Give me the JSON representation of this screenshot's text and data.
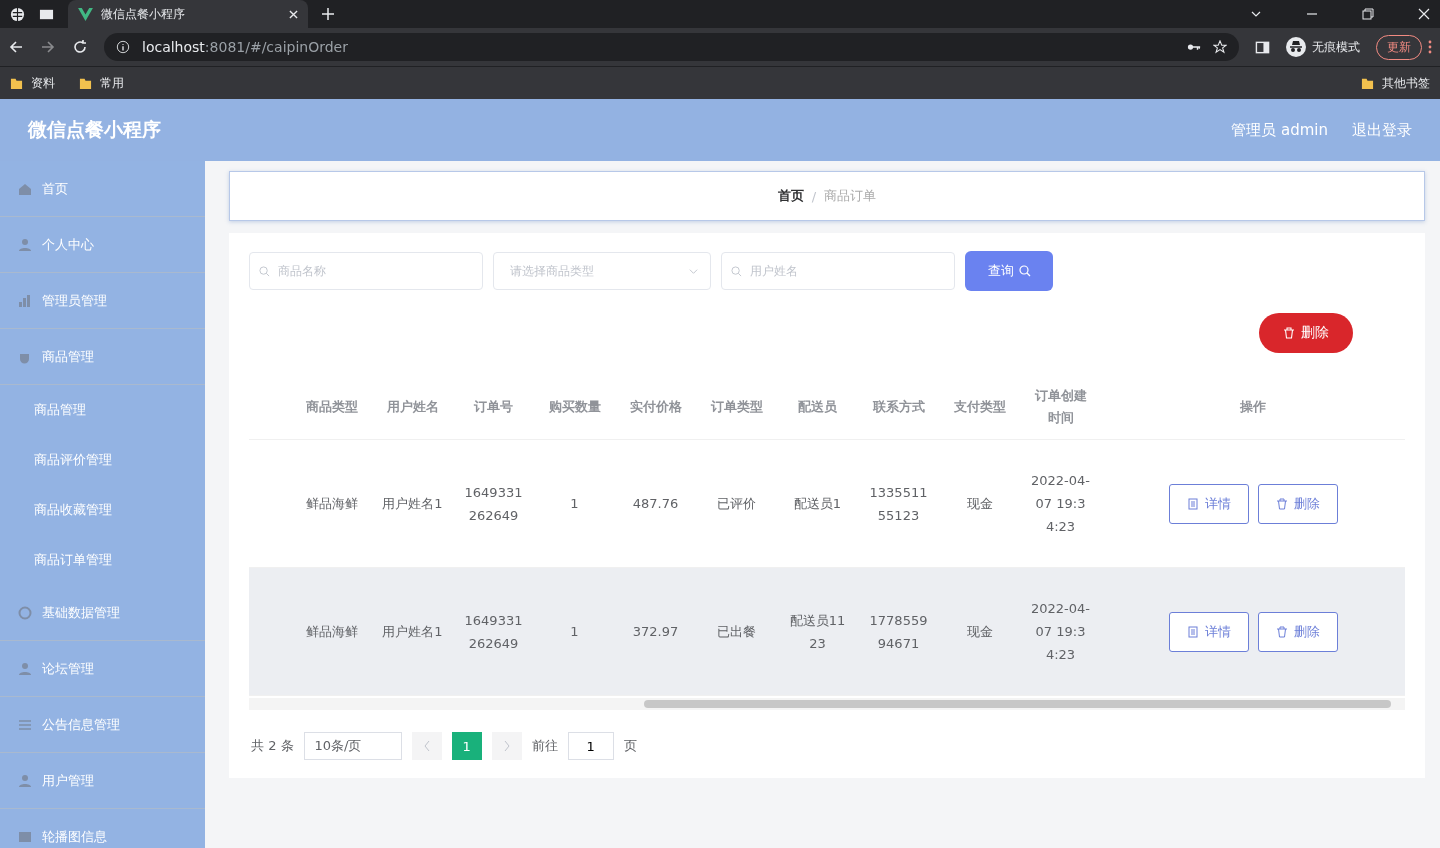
{
  "browser": {
    "tab_title": "微信点餐小程序",
    "url_host": "localhost",
    "url_rest": ":8081/#/caipinOrder",
    "incognito_label": "无痕模式",
    "update_button": "更新",
    "bookmarks": [
      "资料",
      "常用"
    ],
    "other_bookmarks": "其他书签"
  },
  "header": {
    "title": "微信点餐小程序",
    "user": "管理员 admin",
    "logout": "退出登录"
  },
  "sidebar": {
    "items": [
      {
        "label": "首页"
      },
      {
        "label": "个人中心"
      },
      {
        "label": "管理员管理"
      },
      {
        "label": "商品管理",
        "children": [
          {
            "label": "商品管理"
          },
          {
            "label": "商品评价管理"
          },
          {
            "label": "商品收藏管理"
          },
          {
            "label": "商品订单管理"
          }
        ]
      },
      {
        "label": "基础数据管理"
      },
      {
        "label": "论坛管理"
      },
      {
        "label": "公告信息管理"
      },
      {
        "label": "用户管理"
      },
      {
        "label": "轮播图信息"
      }
    ]
  },
  "breadcrumb": [
    "首页",
    "商品订单"
  ],
  "breadcrumb_separator": "/",
  "search": {
    "name_placeholder": "商品名称",
    "type_placeholder": "请选择商品类型",
    "user_placeholder": "用户姓名",
    "query_button": "查询"
  },
  "delete_button": "删除",
  "table": {
    "columns": [
      "商品类型",
      "用户姓名",
      "订单号",
      "购买数量",
      "实付价格",
      "订单类型",
      "配送员",
      "联系方式",
      "支付类型",
      "订单创建时间",
      "操作"
    ],
    "rows": [
      {
        "highlighted": false,
        "cells": [
          "鲜品海鲜",
          "用户姓名1",
          "1649331262649",
          "1",
          "487.76",
          "已评价",
          "配送员1",
          "133551155123",
          "现金",
          "2022-04-07 19:34:23"
        ],
        "actions": [
          "详情",
          "删除"
        ]
      },
      {
        "highlighted": true,
        "cells": [
          "鲜品海鲜",
          "用户姓名1",
          "1649331262649",
          "1",
          "372.97",
          "已出餐",
          "配送员1123",
          "177855994671",
          "现金",
          "2022-04-07 19:34:23"
        ],
        "actions": [
          "详情",
          "删除"
        ]
      }
    ]
  },
  "pagination": {
    "total": "共 2 条",
    "page_size": "10条/页",
    "pages": [
      {
        "label": "1",
        "selected": true
      }
    ],
    "goto_label": "前往",
    "goto_value": "1",
    "page_suffix": "页"
  }
}
